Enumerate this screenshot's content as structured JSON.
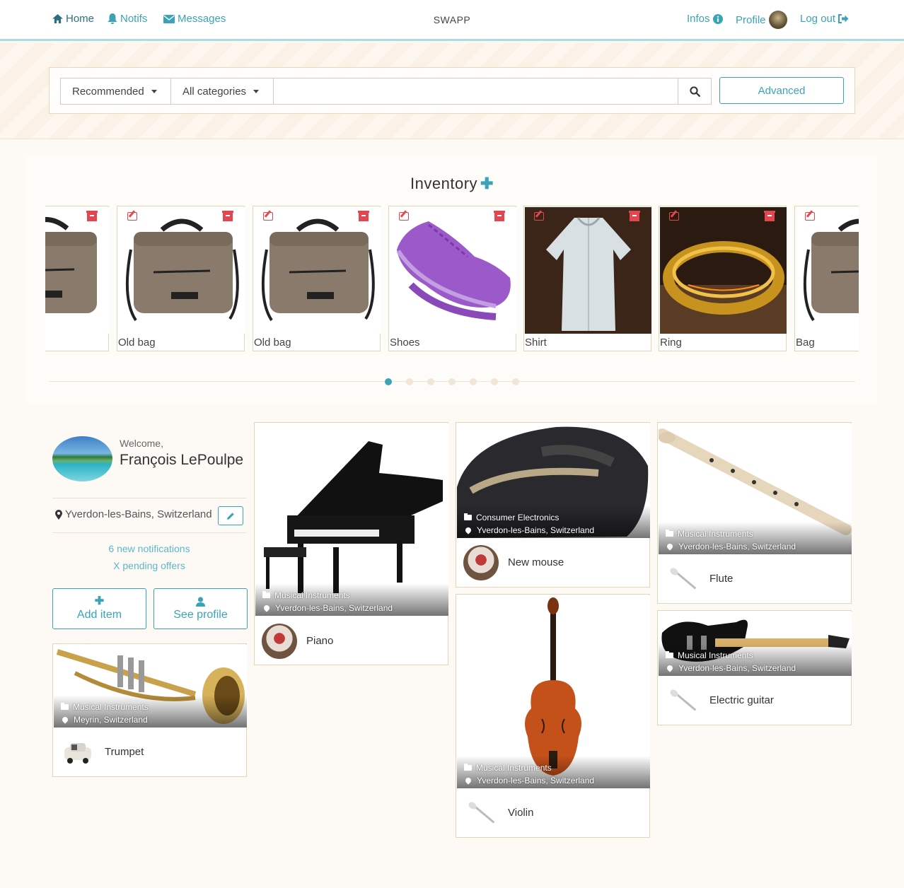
{
  "nav": {
    "home": "Home",
    "notifs": "Notifs",
    "messages": "Messages",
    "brand": "SWAPP",
    "infos": "Infos",
    "profile": "Profile",
    "logout": "Log out"
  },
  "search": {
    "sort": "Recommended",
    "category": "All categories",
    "query": "",
    "advanced": "Advanced"
  },
  "inventory": {
    "title": "Inventory",
    "items": [
      {
        "name": ""
      },
      {
        "name": "Old bag"
      },
      {
        "name": "Old bag"
      },
      {
        "name": "Shoes"
      },
      {
        "name": "Shirt"
      },
      {
        "name": "Ring"
      },
      {
        "name": "Bag"
      }
    ],
    "page_count": 7,
    "active_page": 1
  },
  "profile": {
    "welcome": "Welcome,",
    "name": "François LePoulpe",
    "location": "Yverdon-les-Bains, Switzerland",
    "notifications": "6 new notifications",
    "offers": "X pending offers",
    "add_item": "Add item",
    "see_profile": "See profile"
  },
  "items": [
    {
      "name": "Trumpet",
      "category": "Musical Instruments",
      "location": "Meyrin, Switzerland"
    },
    {
      "name": "Piano",
      "category": "Musical Instruments",
      "location": "Yverdon-les-Bains, Switzerland"
    },
    {
      "name": "New mouse",
      "category": "Consumer Electronics",
      "location": "Yverdon-les-Bains, Switzerland"
    },
    {
      "name": "Violin",
      "category": "Musical Instruments",
      "location": "Yverdon-les-Bains, Switzerland"
    },
    {
      "name": "Flute",
      "category": "Musical Instruments",
      "location": "Yverdon-les-Bains, Switzerland"
    },
    {
      "name": "Electric guitar",
      "category": "Musical Instruments",
      "location": "Yverdon-les-Bains, Switzerland"
    }
  ],
  "colors": {
    "accent": "#3aa3b8",
    "danger": "#e2474f",
    "card_border": "#e3d5b4"
  }
}
